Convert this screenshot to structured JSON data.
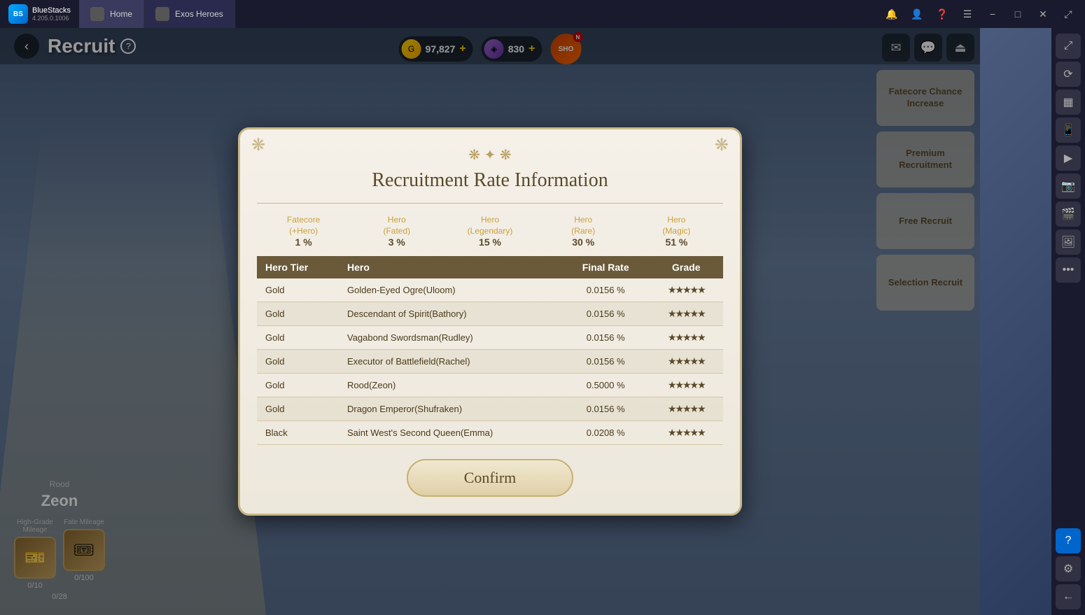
{
  "titlebar": {
    "app_name": "BlueStacks",
    "version": "4.205.0.1006",
    "tab_home": "Home",
    "tab_game": "Exos Heroes",
    "controls": {
      "bell": "🔔",
      "user": "👤",
      "help": "❓",
      "menu": "☰",
      "minimize": "−",
      "maximize": "□",
      "close": "✕",
      "expand": "⤢"
    }
  },
  "page": {
    "title": "Recruit",
    "back_icon": "‹",
    "help_icon": "?"
  },
  "currency": {
    "gold_amount": "97,827",
    "gold_add": "+",
    "purple_amount": "830",
    "purple_add": "+",
    "shop_label": "SHO",
    "notification": "N"
  },
  "top_right_icons": {
    "mail": "✉",
    "chat": "💬",
    "logout": "⏏"
  },
  "hero": {
    "title": "Rood",
    "name": "Zeon",
    "mileage": {
      "high_grade_label": "High-Grade\nMileage",
      "fate_label": "Fate Mileage",
      "high_grade_count": "0/10",
      "fate_count": "0/100",
      "extra_count": "0/28"
    }
  },
  "sidebar": {
    "fatecore_label": "Fatecore\nChance\nIncrease",
    "premium_label": "Premium\nRecruitment",
    "free_label": "Free\nRecruit",
    "selection_label": "Selection\nRecruit"
  },
  "modal": {
    "title": "Recruitment Rate Information",
    "ornament": "❋ ✦ ❋",
    "rate_categories": [
      {
        "label": "Fatecore\n(+Hero)",
        "value": "1 %"
      },
      {
        "label": "Hero\n(Fated)",
        "value": "3 %"
      },
      {
        "label": "Hero\n(Legendary)",
        "value": "15 %"
      },
      {
        "label": "Hero\n(Rare)",
        "value": "30 %"
      },
      {
        "label": "Hero\n(Magic)",
        "value": "51 %"
      }
    ],
    "table": {
      "headers": [
        "Hero Tier",
        "Hero",
        "Final Rate",
        "Grade"
      ],
      "rows": [
        {
          "tier": "Gold",
          "hero": "Golden-Eyed Ogre(Uloom)",
          "rate": "0.0156 %",
          "grade": "★★★★★"
        },
        {
          "tier": "Gold",
          "hero": "Descendant of Spirit(Bathory)",
          "rate": "0.0156 %",
          "grade": "★★★★★"
        },
        {
          "tier": "Gold",
          "hero": "Vagabond Swordsman(Rudley)",
          "rate": "0.0156 %",
          "grade": "★★★★★"
        },
        {
          "tier": "Gold",
          "hero": "Executor of Battlefield(Rachel)",
          "rate": "0.0156 %",
          "grade": "★★★★★"
        },
        {
          "tier": "Gold",
          "hero": "Rood(Zeon)",
          "rate": "0.5000 %",
          "grade": "★★★★★"
        },
        {
          "tier": "Gold",
          "hero": "Dragon Emperor(Shufraken)",
          "rate": "0.0156 %",
          "grade": "★★★★★"
        },
        {
          "tier": "Black",
          "hero": "Saint West's Second Queen(Emma)",
          "rate": "0.0208 %",
          "grade": "★★★★★"
        }
      ]
    },
    "confirm_label": "Confirm"
  },
  "right_tools": {
    "expand_icon": "⤢",
    "rotate_icon": "⟳",
    "layout_icon": "▦",
    "phone_icon": "📱",
    "video_icon": "▶",
    "camera_icon": "📷",
    "video2_icon": "🎬",
    "gallery_icon": "🖼",
    "dots_icon": "•••",
    "question_icon": "?",
    "settings_icon": "⚙",
    "back_icon": "←"
  }
}
